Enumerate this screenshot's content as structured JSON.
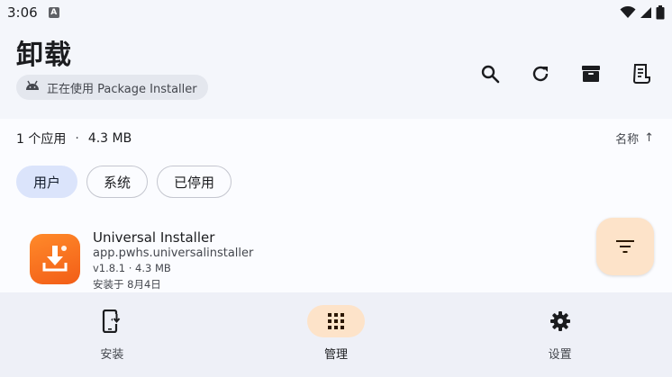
{
  "status_bar": {
    "time": "3:06",
    "app_icon": "A",
    "icons": [
      "wifi-icon",
      "signal-icon",
      "battery-icon"
    ]
  },
  "header": {
    "title": "卸载",
    "installer_chip": "正在使用 Package Installer",
    "actions": [
      "search-icon",
      "refresh-icon",
      "archive-icon",
      "receipt-icon"
    ]
  },
  "summary": {
    "count": "1 个应用",
    "separator": "·",
    "size": "4.3 MB"
  },
  "sort": {
    "label": "名称",
    "arrow": "↑"
  },
  "tabs": [
    {
      "label": "用户",
      "active": true
    },
    {
      "label": "系统",
      "active": false
    },
    {
      "label": "已停用",
      "active": false
    }
  ],
  "apps": [
    {
      "name": "Universal Installer",
      "package": "app.pwhs.universalinstaller",
      "meta": "v1.8.1 · 4.3 MB",
      "installed": "安装于 8月4日"
    }
  ],
  "bottom_nav": [
    {
      "label": "安装",
      "icon": "install-phone-icon",
      "active": false
    },
    {
      "label": "管理",
      "icon": "grid-icon",
      "active": true
    },
    {
      "label": "设置",
      "icon": "gear-icon",
      "active": false
    }
  ],
  "colors": {
    "accent_container": "#fde3c9",
    "tab_active": "#dbe4fb",
    "app_icon": "#f25d17"
  }
}
